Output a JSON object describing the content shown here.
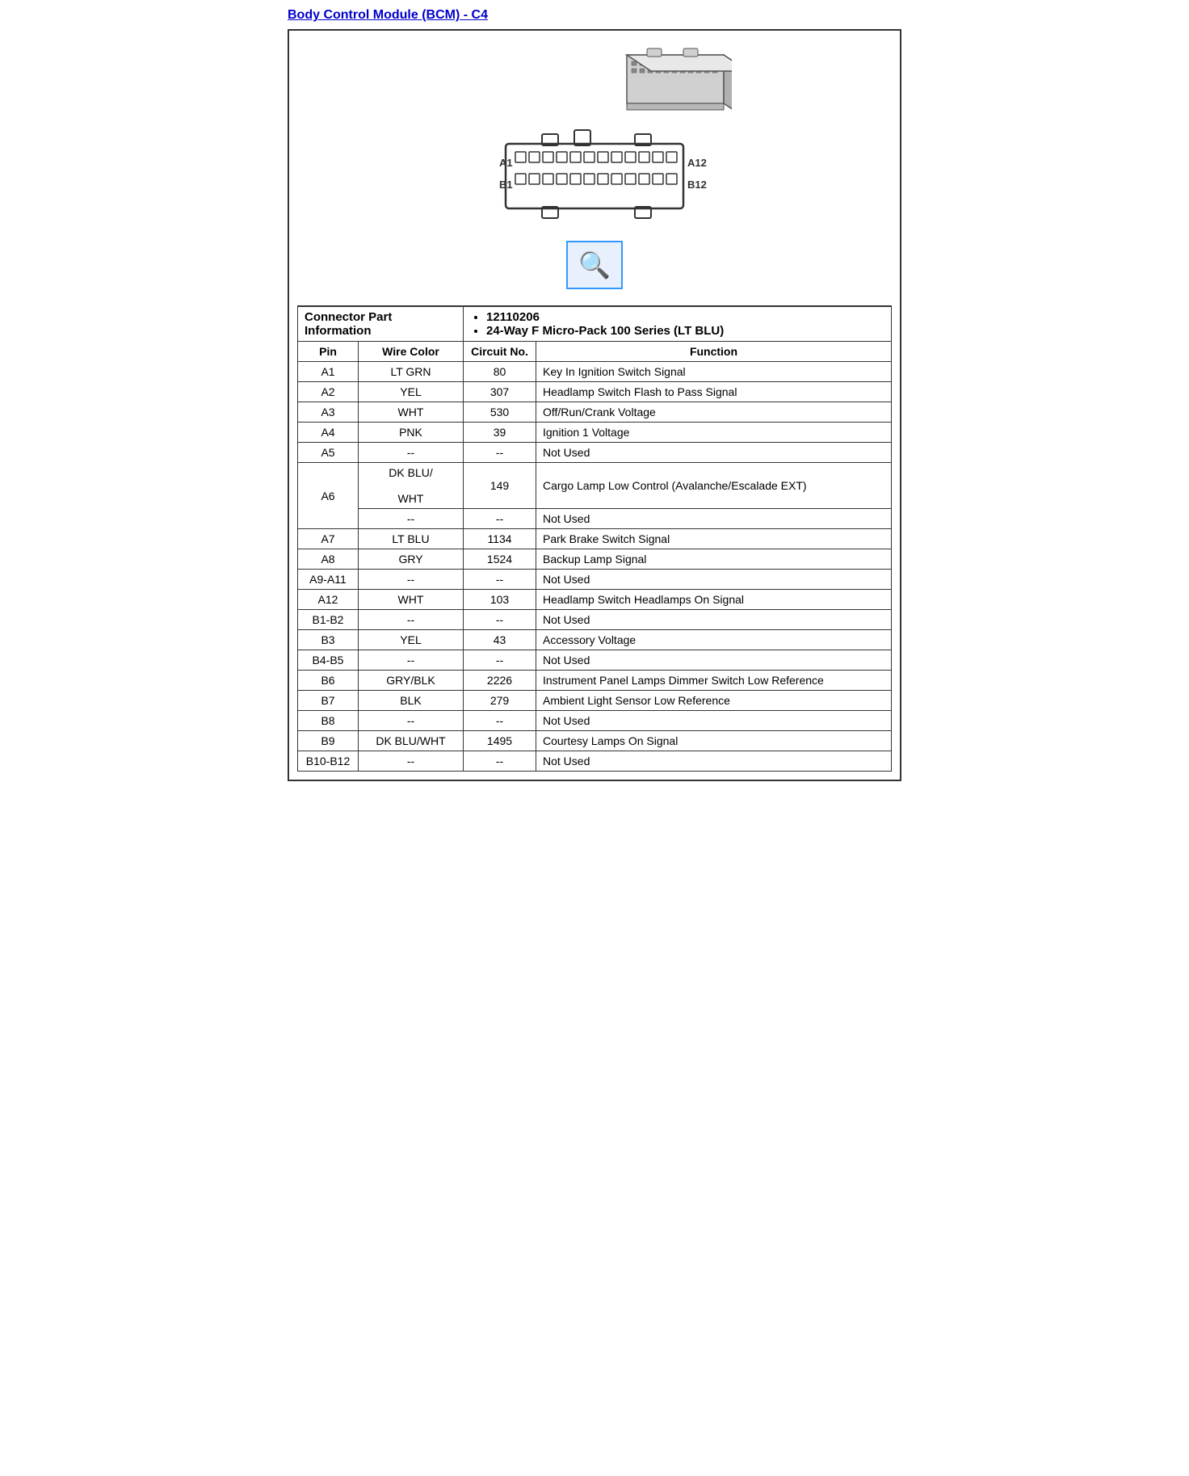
{
  "title": "Body Control Module (BCM) - C4",
  "connector_part_label": "Connector Part Information",
  "part_numbers": [
    "12110206",
    "24-Way F Micro-Pack 100 Series (LT BLU)"
  ],
  "table_headers": {
    "pin": "Pin",
    "wire_color": "Wire Color",
    "circuit_no": "Circuit No.",
    "function": "Function"
  },
  "rows": [
    {
      "pin": "A1",
      "wire": "LT GRN",
      "circuit": "80",
      "function": "Key In Ignition Switch Signal"
    },
    {
      "pin": "A2",
      "wire": "YEL",
      "circuit": "307",
      "function": "Headlamp Switch Flash to Pass Signal"
    },
    {
      "pin": "A3",
      "wire": "WHT",
      "circuit": "530",
      "function": "Off/Run/Crank Voltage"
    },
    {
      "pin": "A4",
      "wire": "PNK",
      "circuit": "39",
      "function": "Ignition 1 Voltage"
    },
    {
      "pin": "A5",
      "wire": "--",
      "circuit": "--",
      "function": "Not Used"
    },
    {
      "pin": "A6",
      "wire": "DK BLU/\n\nWHT",
      "circuit": "149",
      "function": "Cargo Lamp Low Control (Avalanche/Escalade EXT)",
      "extra_row": true,
      "extra_wire": "--",
      "extra_circuit": "--",
      "extra_function": "Not Used"
    },
    {
      "pin": "A7",
      "wire": "LT BLU",
      "circuit": "1134",
      "function": "Park Brake Switch Signal"
    },
    {
      "pin": "A8",
      "wire": "GRY",
      "circuit": "1524",
      "function": "Backup Lamp Signal"
    },
    {
      "pin": "A9-A11",
      "wire": "--",
      "circuit": "--",
      "function": "Not Used"
    },
    {
      "pin": "A12",
      "wire": "WHT",
      "circuit": "103",
      "function": "Headlamp Switch Headlamps On Signal"
    },
    {
      "pin": "B1-B2",
      "wire": "--",
      "circuit": "--",
      "function": "Not Used"
    },
    {
      "pin": "B3",
      "wire": "YEL",
      "circuit": "43",
      "function": "Accessory Voltage"
    },
    {
      "pin": "B4-B5",
      "wire": "--",
      "circuit": "--",
      "function": "Not Used"
    },
    {
      "pin": "B6",
      "wire": "GRY/BLK",
      "circuit": "2226",
      "function": "Instrument Panel Lamps Dimmer Switch Low Reference"
    },
    {
      "pin": "B7",
      "wire": "BLK",
      "circuit": "279",
      "function": "Ambient Light Sensor Low Reference"
    },
    {
      "pin": "B8",
      "wire": "--",
      "circuit": "--",
      "function": "Not Used"
    },
    {
      "pin": "B9",
      "wire": "DK BLU/WHT",
      "circuit": "1495",
      "function": "Courtesy Lamps On Signal"
    },
    {
      "pin": "B10-B12",
      "wire": "--",
      "circuit": "--",
      "function": "Not Used"
    }
  ]
}
